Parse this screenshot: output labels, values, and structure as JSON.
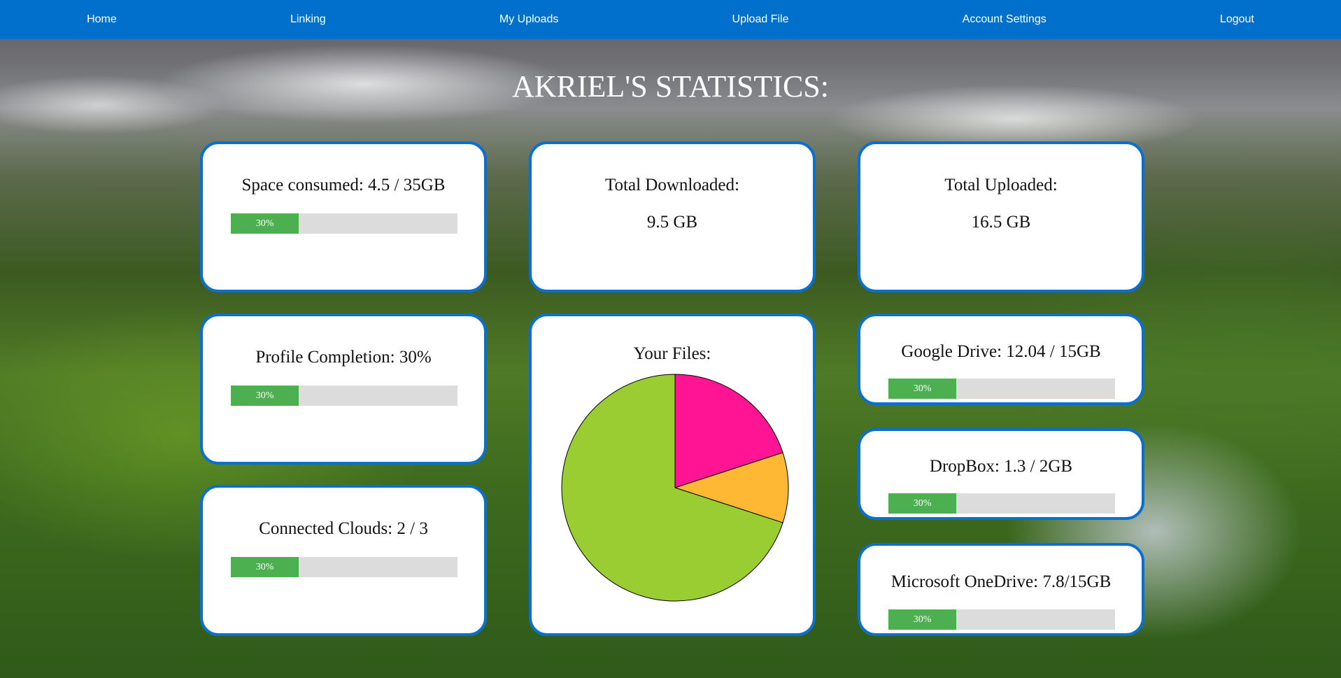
{
  "nav": {
    "items": [
      {
        "label": "Home"
      },
      {
        "label": "Linking"
      },
      {
        "label": "My Uploads"
      },
      {
        "label": "Upload File"
      },
      {
        "label": "Account Settings"
      },
      {
        "label": "Logout"
      }
    ]
  },
  "page": {
    "title": "AKRIEL'S STATISTICS:"
  },
  "cards": {
    "space": {
      "label": "Space consumed: 4.5 / 35GB",
      "bar_text": "30%",
      "bar_fraction": 0.3
    },
    "downloaded": {
      "label": "Total Downloaded:",
      "value": "9.5 GB"
    },
    "uploaded": {
      "label": "Total Uploaded:",
      "value": "16.5 GB"
    },
    "profile": {
      "label": "Profile Completion: 30%",
      "bar_text": "30%",
      "bar_fraction": 0.3
    },
    "clouds": {
      "label": "Connected Clouds: 2 / 3",
      "bar_text": "30%",
      "bar_fraction": 0.3
    },
    "files": {
      "label": "Your Files:"
    },
    "gdrive": {
      "label": "Google Drive: 12.04 / 15GB",
      "bar_text": "30%",
      "bar_fraction": 0.3
    },
    "dropbox": {
      "label": "DropBox: 1.3 / 2GB",
      "bar_text": "30%",
      "bar_fraction": 0.3
    },
    "onedrive": {
      "label": "Microsoft OneDrive: 7.8/15GB",
      "bar_text": "30%",
      "bar_fraction": 0.3
    }
  },
  "chart_data": {
    "type": "pie",
    "title": "Your Files:",
    "slices": [
      {
        "value": 20,
        "color": "#ff1493"
      },
      {
        "value": 10,
        "color": "#ffb833"
      },
      {
        "value": 70,
        "color": "#9acd32"
      }
    ]
  }
}
